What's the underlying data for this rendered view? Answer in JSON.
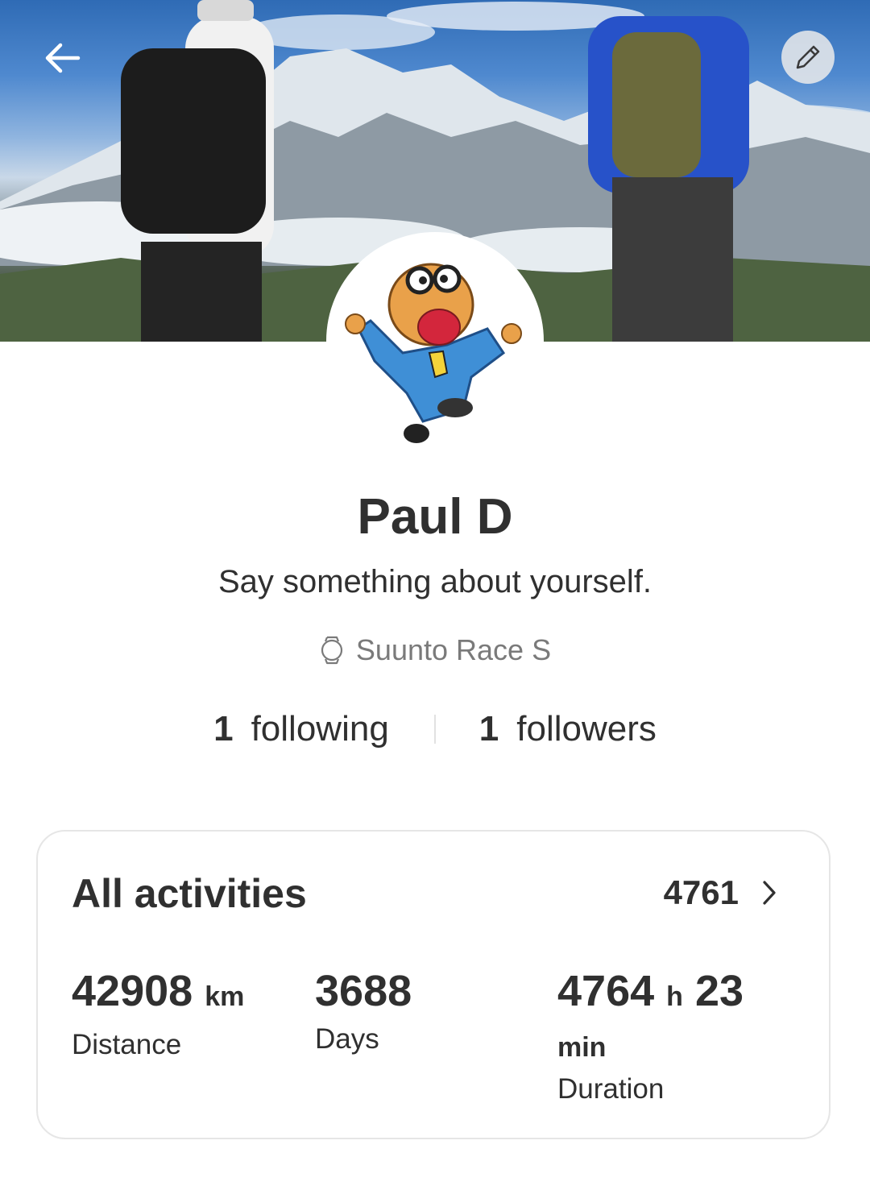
{
  "header": {
    "back_icon": "arrow-left-icon",
    "edit_icon": "pencil-icon"
  },
  "profile": {
    "name": "Paul D",
    "bio": "Say something about yourself.",
    "device_icon": "watch-icon",
    "device": "Suunto Race S",
    "following_count": "1",
    "following_label": "following",
    "followers_count": "1",
    "followers_label": "followers"
  },
  "activities": {
    "title": "All activities",
    "count": "4761",
    "chevron_icon": "chevron-right-icon",
    "distance_value": "42908",
    "distance_unit": "km",
    "distance_label": "Distance",
    "days_value": "3688",
    "days_label": "Days",
    "duration_hours": "4764",
    "duration_h_unit": "h",
    "duration_minutes": "23",
    "duration_min_unit": "min",
    "duration_label": "Duration"
  }
}
